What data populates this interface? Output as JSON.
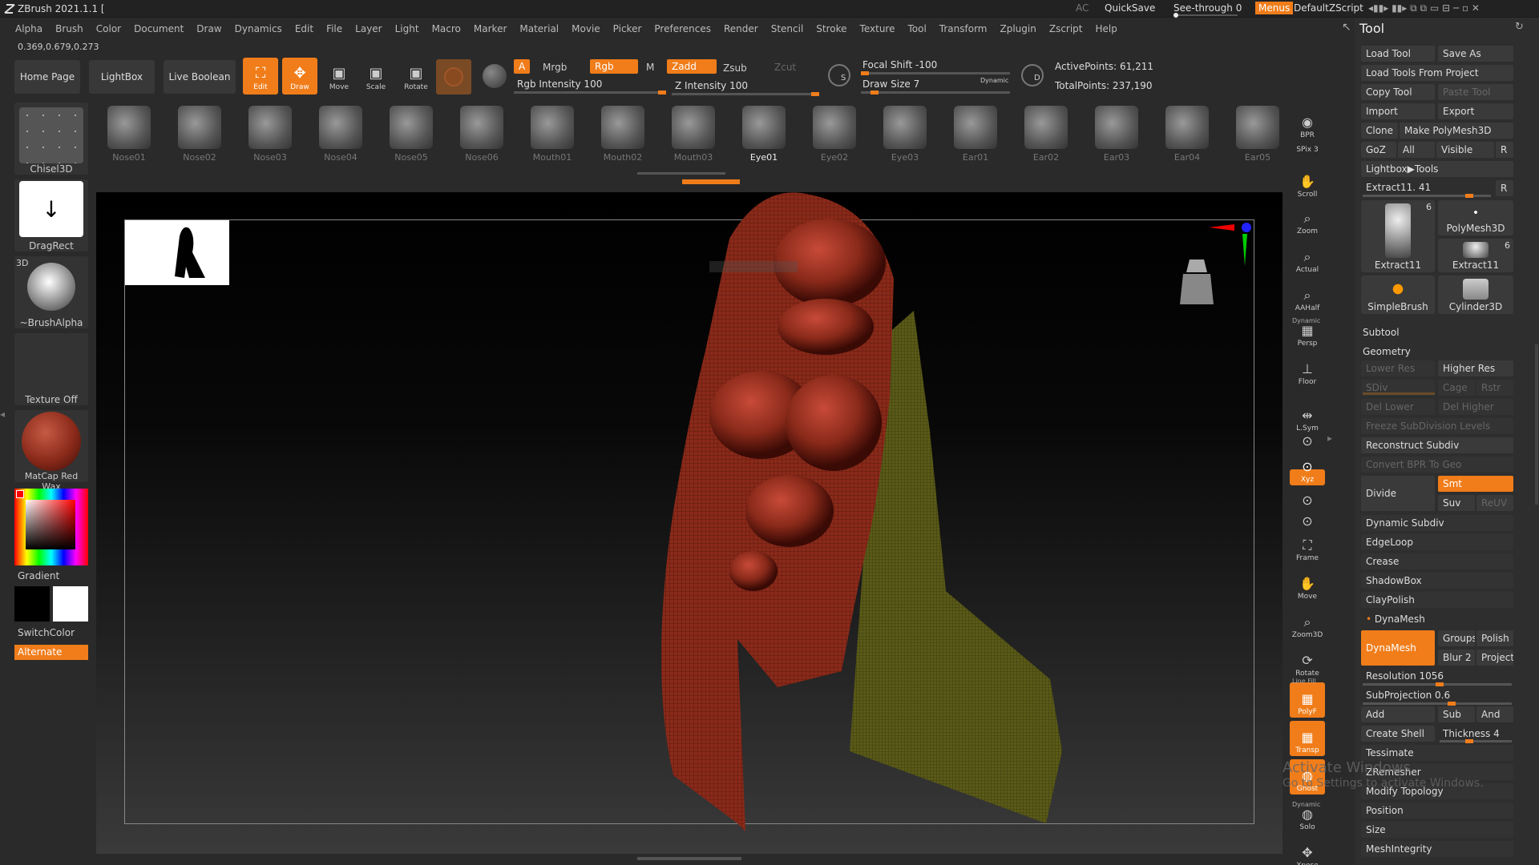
{
  "titlebar": {
    "app": "ZBrush 2021.1.1 [",
    "ac": "AC",
    "quicksave": "QuickSave",
    "see_through": "See-through",
    "see_through_val": "0",
    "menus": "Menus",
    "script": "DefaultZScript"
  },
  "menu": [
    "Alpha",
    "Brush",
    "Color",
    "Document",
    "Draw",
    "Dynamics",
    "Edit",
    "File",
    "Layer",
    "Light",
    "Macro",
    "Marker",
    "Material",
    "Movie",
    "Picker",
    "Preferences",
    "Render",
    "Stencil",
    "Stroke",
    "Texture",
    "Tool",
    "Transform",
    "Zplugin",
    "Zscript",
    "Help"
  ],
  "coords": "0.369,0.679,0.273",
  "toolbar": {
    "home": "Home Page",
    "lightbox": "LightBox",
    "liveboolean": "Live Boolean",
    "edit": "Edit",
    "draw": "Draw",
    "move": "Move",
    "scale": "Scale",
    "rotate": "Rotate",
    "a": "A",
    "mrgb": "Mrgb",
    "rgb": "Rgb",
    "m": "M",
    "zadd": "Zadd",
    "zsub": "Zsub",
    "zcut": "Zcut",
    "rgb_intensity": "Rgb Intensity 100",
    "z_intensity": "Z Intensity 100",
    "focal_shift": "Focal Shift -100",
    "draw_size": "Draw Size 7",
    "dynamic": "Dynamic",
    "active_points": "ActivePoints: 61,211",
    "total_points": "TotalPoints: 237,190",
    "rgb_intensity_val": 100,
    "z_intensity_val": 100,
    "focal_shift_val": -100,
    "draw_size_val": 7
  },
  "lightbox_items": [
    "Nose01",
    "Nose02",
    "Nose03",
    "Nose04",
    "Nose05",
    "Nose06",
    "Mouth01",
    "Mouth02",
    "Mouth03",
    "Eye01",
    "Eye02",
    "Eye03",
    "Ear01",
    "Ear02",
    "Ear03",
    "Ear04",
    "Ear05"
  ],
  "lightbox_selected": "Eye01",
  "left": {
    "brush": "Chisel3D",
    "stroke": "DragRect",
    "alpha_3d": "3D",
    "alpha": "~BrushAlpha",
    "texture": "Texture Off",
    "material": "MatCap Red Wax",
    "gradient": "Gradient",
    "switchcolor": "SwitchColor",
    "alternate": "Alternate"
  },
  "nav": [
    "BPR",
    "SPix 3",
    "Scroll",
    "Zoom",
    "Actual",
    "AAHalf",
    "Persp",
    "Floor",
    "L.Sym",
    "",
    "Xyz",
    "",
    "",
    "Frame",
    "Move",
    "Zoom3D",
    "Rotate",
    "PolyF",
    "Transp",
    "Ghost",
    "Solo",
    "Xpose"
  ],
  "nav_dynamic": "Dynamic",
  "nav_linefill": "Line Fill",
  "tool": {
    "header": "Tool",
    "load": "Load Tool",
    "saveas": "Save As",
    "loadfromproject": "Load Tools From Project",
    "copy": "Copy Tool",
    "paste": "Paste Tool",
    "import": "Import",
    "export": "Export",
    "clone": "Clone",
    "makepoly": "Make PolyMesh3D",
    "goz": "GoZ",
    "all": "All",
    "visible": "Visible",
    "r": "R",
    "lightbox_tools": "Lightbox▶Tools",
    "extract_label": "Extract11. 41",
    "extract_val": 41,
    "tiles": [
      {
        "name": "Extract11",
        "count": "6"
      },
      {
        "name": "PolyMesh3D",
        "count": ""
      },
      {
        "name": "Extract11",
        "count": "6"
      },
      {
        "name": "SimpleBrush",
        "count": ""
      },
      {
        "name": "Cylinder3D",
        "count": ""
      }
    ],
    "subtool": "Subtool",
    "geometry": "Geometry",
    "lower_res": "Lower Res",
    "higher_res": "Higher Res",
    "sdiv": "SDiv",
    "cage": "Cage",
    "rstr": "Rstr",
    "del_lower": "Del Lower",
    "del_higher": "Del Higher",
    "freeze": "Freeze SubDivision Levels",
    "reconstruct": "Reconstruct Subdiv",
    "convert_bpr": "Convert BPR To Geo",
    "divide": "Divide",
    "smt": "Smt",
    "suv": "Suv",
    "reuv": "ReUV",
    "dynamic_subdiv": "Dynamic Subdiv",
    "edgeloop": "EdgeLoop",
    "crease": "Crease",
    "shadowbox": "ShadowBox",
    "claypolish": "ClayPolish",
    "dynamesh_section": "DynaMesh",
    "dynamesh_btn": "DynaMesh",
    "groups": "Groups",
    "polish": "Polish",
    "blur": "Blur 2",
    "project": "Project",
    "resolution": "Resolution 1056",
    "subprojection": "SubProjection 0.6",
    "resolution_val": 1056,
    "subprojection_val": 0.6,
    "add": "Add",
    "sub": "Sub",
    "and": "And",
    "create_shell": "Create Shell",
    "thickness": "Thickness 4",
    "thickness_val": 4,
    "tessimate": "Tessimate",
    "zremesher": "ZRemesher",
    "modify_topology": "Modify Topology",
    "position": "Position",
    "size": "Size",
    "meshintegrity": "MeshIntegrity"
  },
  "watermark": {
    "line1": "Activate Windows",
    "line2": "Go to Settings to activate Windows."
  },
  "colors": {
    "accent": "#f07d1a",
    "mesh_red": "#8a2a1a",
    "mesh_olive": "#5a5a18"
  }
}
